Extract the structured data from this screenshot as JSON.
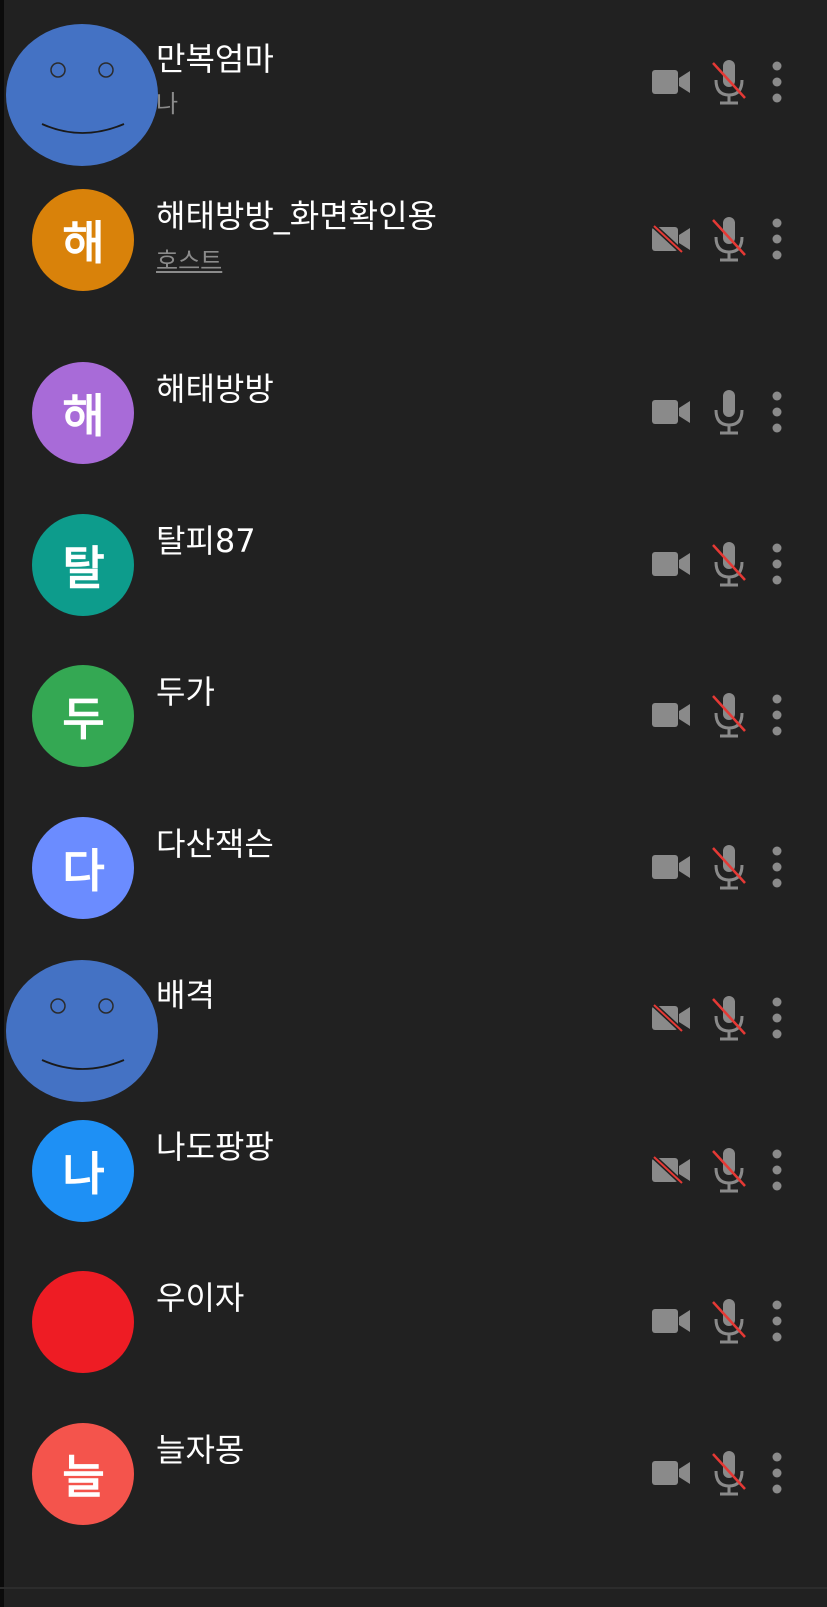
{
  "participants": [
    {
      "name": "만복엄마",
      "subtitle": "나",
      "avatar": {
        "type": "smiley",
        "color": "#4472c4"
      },
      "camera": "on",
      "mic": "muted"
    },
    {
      "name": "해태방방_화면확인용",
      "subtitle": "호스트",
      "avatar": {
        "type": "letter",
        "letter": "해",
        "color": "#d9820a"
      },
      "camera": "off",
      "mic": "muted"
    },
    {
      "name": "해태방방",
      "subtitle": "",
      "avatar": {
        "type": "letter",
        "letter": "해",
        "color": "#a86bd8"
      },
      "camera": "on",
      "mic": "on"
    },
    {
      "name": "탈피87",
      "subtitle": "",
      "avatar": {
        "type": "letter",
        "letter": "탈",
        "color": "#0d9c8c"
      },
      "camera": "on",
      "mic": "muted"
    },
    {
      "name": "두가",
      "subtitle": "",
      "avatar": {
        "type": "letter",
        "letter": "두",
        "color": "#34a853"
      },
      "camera": "on",
      "mic": "muted"
    },
    {
      "name": "다산잭슨",
      "subtitle": "",
      "avatar": {
        "type": "letter",
        "letter": "다",
        "color": "#6b8cff"
      },
      "camera": "on",
      "mic": "muted"
    },
    {
      "name": "배격",
      "subtitle": "",
      "avatar": {
        "type": "smiley",
        "color": "#4472c4"
      },
      "camera": "off",
      "mic": "muted"
    },
    {
      "name": "나도팡팡",
      "subtitle": "",
      "avatar": {
        "type": "letter",
        "letter": "나",
        "color": "#1e90f5"
      },
      "camera": "off",
      "mic": "muted"
    },
    {
      "name": "우이자",
      "subtitle": "",
      "avatar": {
        "type": "blank",
        "color": "#ee1c24"
      },
      "camera": "on",
      "mic": "muted"
    },
    {
      "name": "늘자몽",
      "subtitle": "",
      "avatar": {
        "type": "letter",
        "letter": "늘",
        "color": "#f4544c"
      },
      "camera": "on",
      "mic": "muted"
    }
  ],
  "icons": {
    "camera": "video-camera-icon",
    "camera_off": "video-camera-off-icon",
    "mic": "microphone-icon",
    "mic_muted": "microphone-muted-icon",
    "more": "more-vertical-icon"
  },
  "colors": {
    "background": "#212121",
    "icon": "#8a8a8a",
    "mute_slash": "#e53935",
    "name_text": "#ffffff",
    "sub_text": "#8b8b8b"
  }
}
